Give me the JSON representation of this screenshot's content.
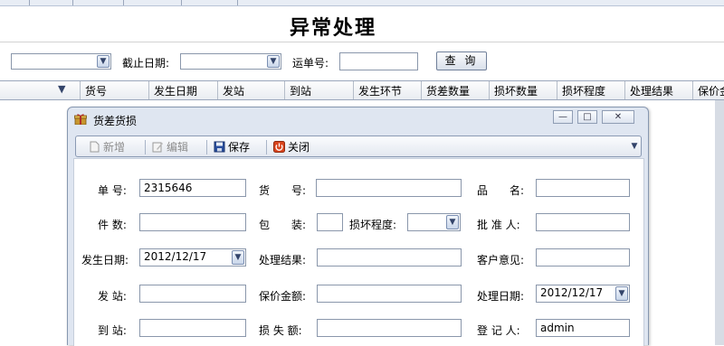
{
  "page": {
    "title": "异常处理"
  },
  "filters": {
    "date_label": "截止日期:",
    "waybill_label": "运单号:",
    "waybill_value": "",
    "query_label": "查 询"
  },
  "grid": {
    "columns": [
      "货号",
      "发生日期",
      "发站",
      "到站",
      "发生环节",
      "货差数量",
      "损坏数量",
      "损坏程度",
      "处理结果",
      "保价金"
    ]
  },
  "dialog": {
    "title": "货差货损",
    "toolbar": {
      "new": "新增",
      "edit": "编辑",
      "save": "保存",
      "close": "关闭"
    },
    "form": {
      "order_no_label": "单 号:",
      "order_no_value": "2315646",
      "goods_no_label": "货　　号:",
      "goods_no_value": "",
      "product_name_label": "品　　名:",
      "product_name_value": "",
      "pieces_label": "件 数:",
      "pieces_value": "",
      "packaging_label": "包　　装:",
      "packaging_value": "",
      "damage_degree_label": "损坏程度:",
      "damage_degree_value": "",
      "approver_label": "批 准 人:",
      "approver_value": "",
      "occur_date_label": "发生日期:",
      "occur_date_value": "2012/12/17",
      "result_label": "处理结果:",
      "result_value": "",
      "customer_opinion_label": "客户意见:",
      "customer_opinion_value": "",
      "from_station_label": "发 站:",
      "from_station_value": "",
      "insured_amount_label": "保价金额:",
      "insured_amount_value": "",
      "handle_date_label": "处理日期:",
      "handle_date_value": "2012/12/17",
      "to_station_label": "到 站:",
      "to_station_value": "",
      "loss_amount_label": "损 失 额:",
      "loss_amount_value": "",
      "recorder_label": "登 记 人:",
      "recorder_value": "admin"
    }
  },
  "colors": {
    "dialog_bg": "#dfe6f1",
    "border": "#8a97ab",
    "save_icon": "#2a4f9e",
    "close_icon": "#d9451e"
  }
}
